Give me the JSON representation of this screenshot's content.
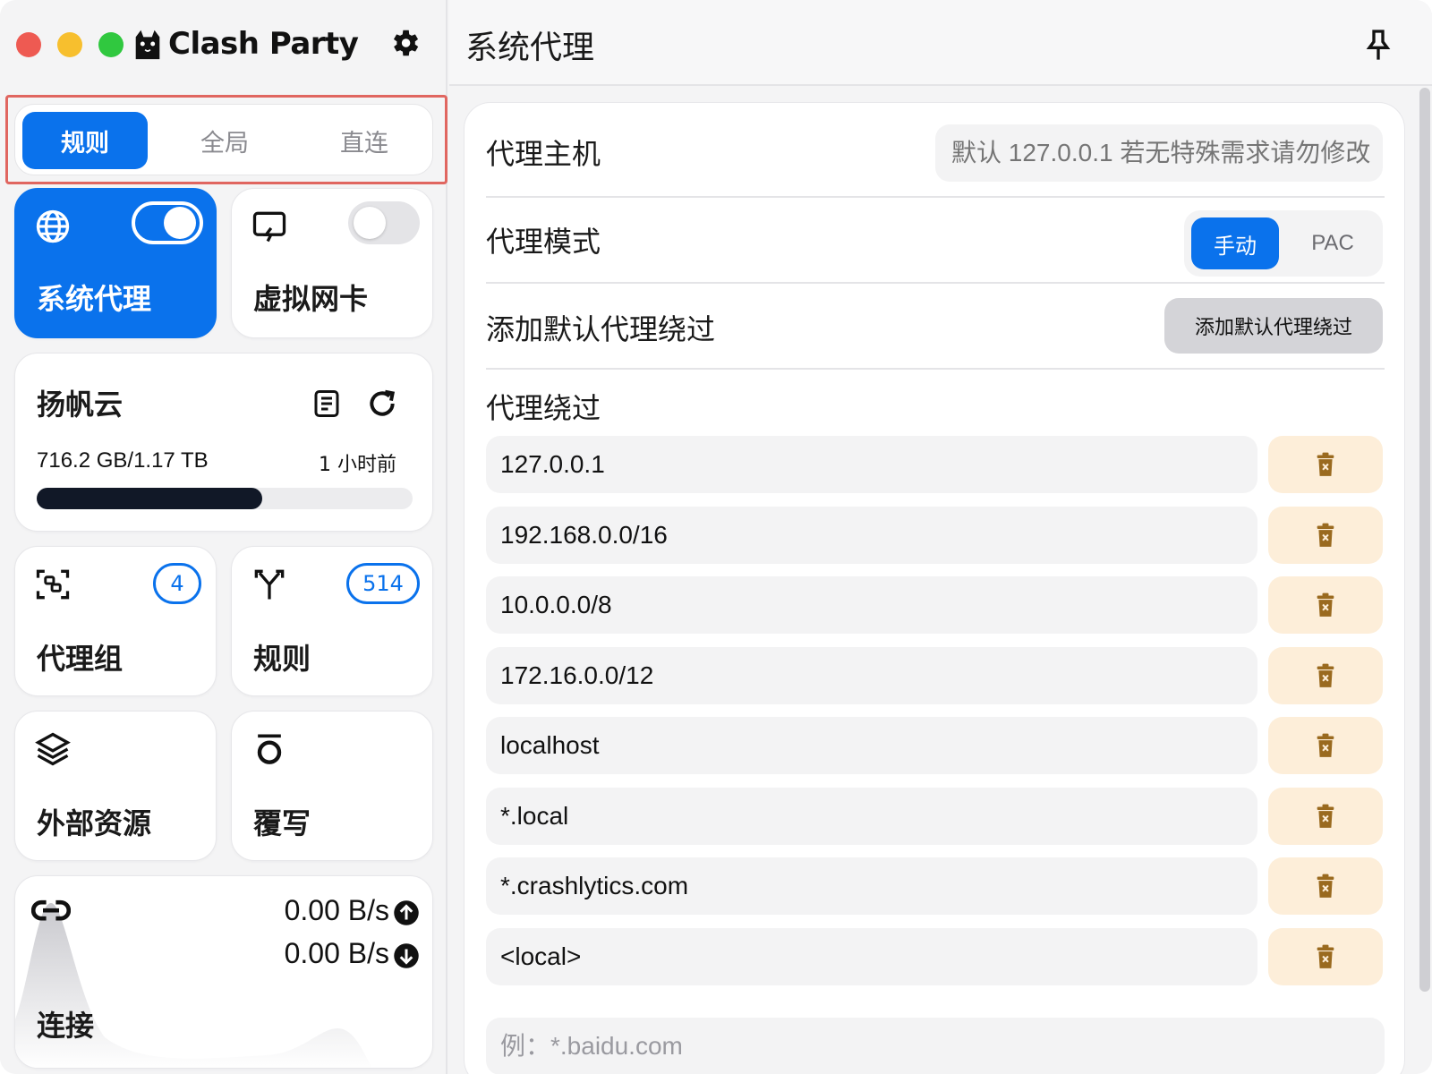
{
  "sidebar": {
    "brand": "Clash Party",
    "mode_tabs": [
      {
        "label": "规则",
        "active": true
      },
      {
        "label": "全局",
        "active": false
      },
      {
        "label": "直连",
        "active": false
      }
    ],
    "cards": {
      "system_proxy": {
        "label": "系统代理",
        "icon": "globe-icon",
        "enabled": true
      },
      "virtual_nic": {
        "label": "虚拟网卡",
        "icon": "monitor-bolt-icon",
        "enabled": false
      },
      "subscription": {
        "name": "扬帆云",
        "usage": "716.2 GB/1.17 TB",
        "updated": "1 小时前",
        "usage_fraction": 0.6
      },
      "proxy_groups": {
        "label": "代理组",
        "count": "4"
      },
      "rules": {
        "label": "规则",
        "count": "514"
      },
      "resources": {
        "label": "外部资源"
      },
      "override": {
        "label": "覆写"
      },
      "connections": {
        "label": "连接",
        "upload": "0.00 B/s",
        "download": "0.00 B/s"
      }
    }
  },
  "main": {
    "title": "系统代理",
    "proxy_host": {
      "label": "代理主机",
      "placeholder": "默认 127.0.0.1 若无特殊需求请勿修改"
    },
    "proxy_mode": {
      "label": "代理模式",
      "options": [
        "手动",
        "PAC"
      ],
      "selected": "手动"
    },
    "add_default_bypass": {
      "label": "添加默认代理绕过",
      "button": "添加默认代理绕过"
    },
    "bypass": {
      "label": "代理绕过",
      "items": [
        "127.0.0.1",
        "192.168.0.0/16",
        "10.0.0.0/8",
        "172.16.0.0/12",
        "localhost",
        "*.local",
        "*.crashlytics.com",
        "<local>"
      ],
      "placeholder": "例：*.baidu.com"
    }
  },
  "colors": {
    "accent": "#0a72ec",
    "delete_bg": "#fdeed9",
    "delete_icon": "#9a6a1f"
  }
}
